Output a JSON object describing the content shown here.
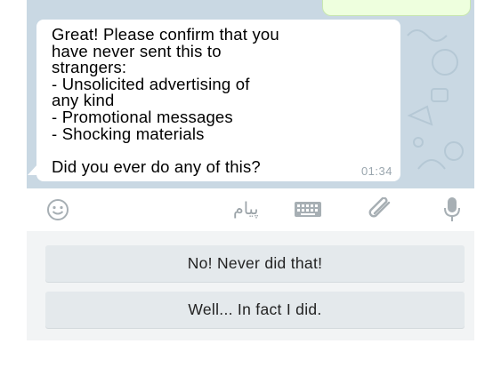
{
  "chat": {
    "message": {
      "text": "Great! Please confirm that you\nhave never sent this to\nstrangers:\n- Unsolicited advertising of\nany kind\n- Promotional messages\n- Shocking materials\n\nDid you ever do any of this?",
      "time": "01:34"
    }
  },
  "input_bar": {
    "placeholder": "پیام",
    "icons": [
      "smiley-icon",
      "keyboard-icon",
      "paperclip-icon",
      "microphone-icon"
    ]
  },
  "reply_keyboard": {
    "buttons": [
      {
        "label": "No! Never did that!"
      },
      {
        "label": "Well... In fact I did."
      }
    ]
  },
  "colors": {
    "wallpaper": "#c9d8e3",
    "bubble": "#ffffff",
    "keyboard_bg": "#f2f4f5",
    "button_bg": "#e4e9ec",
    "icon_gray": "#a7afb4"
  }
}
